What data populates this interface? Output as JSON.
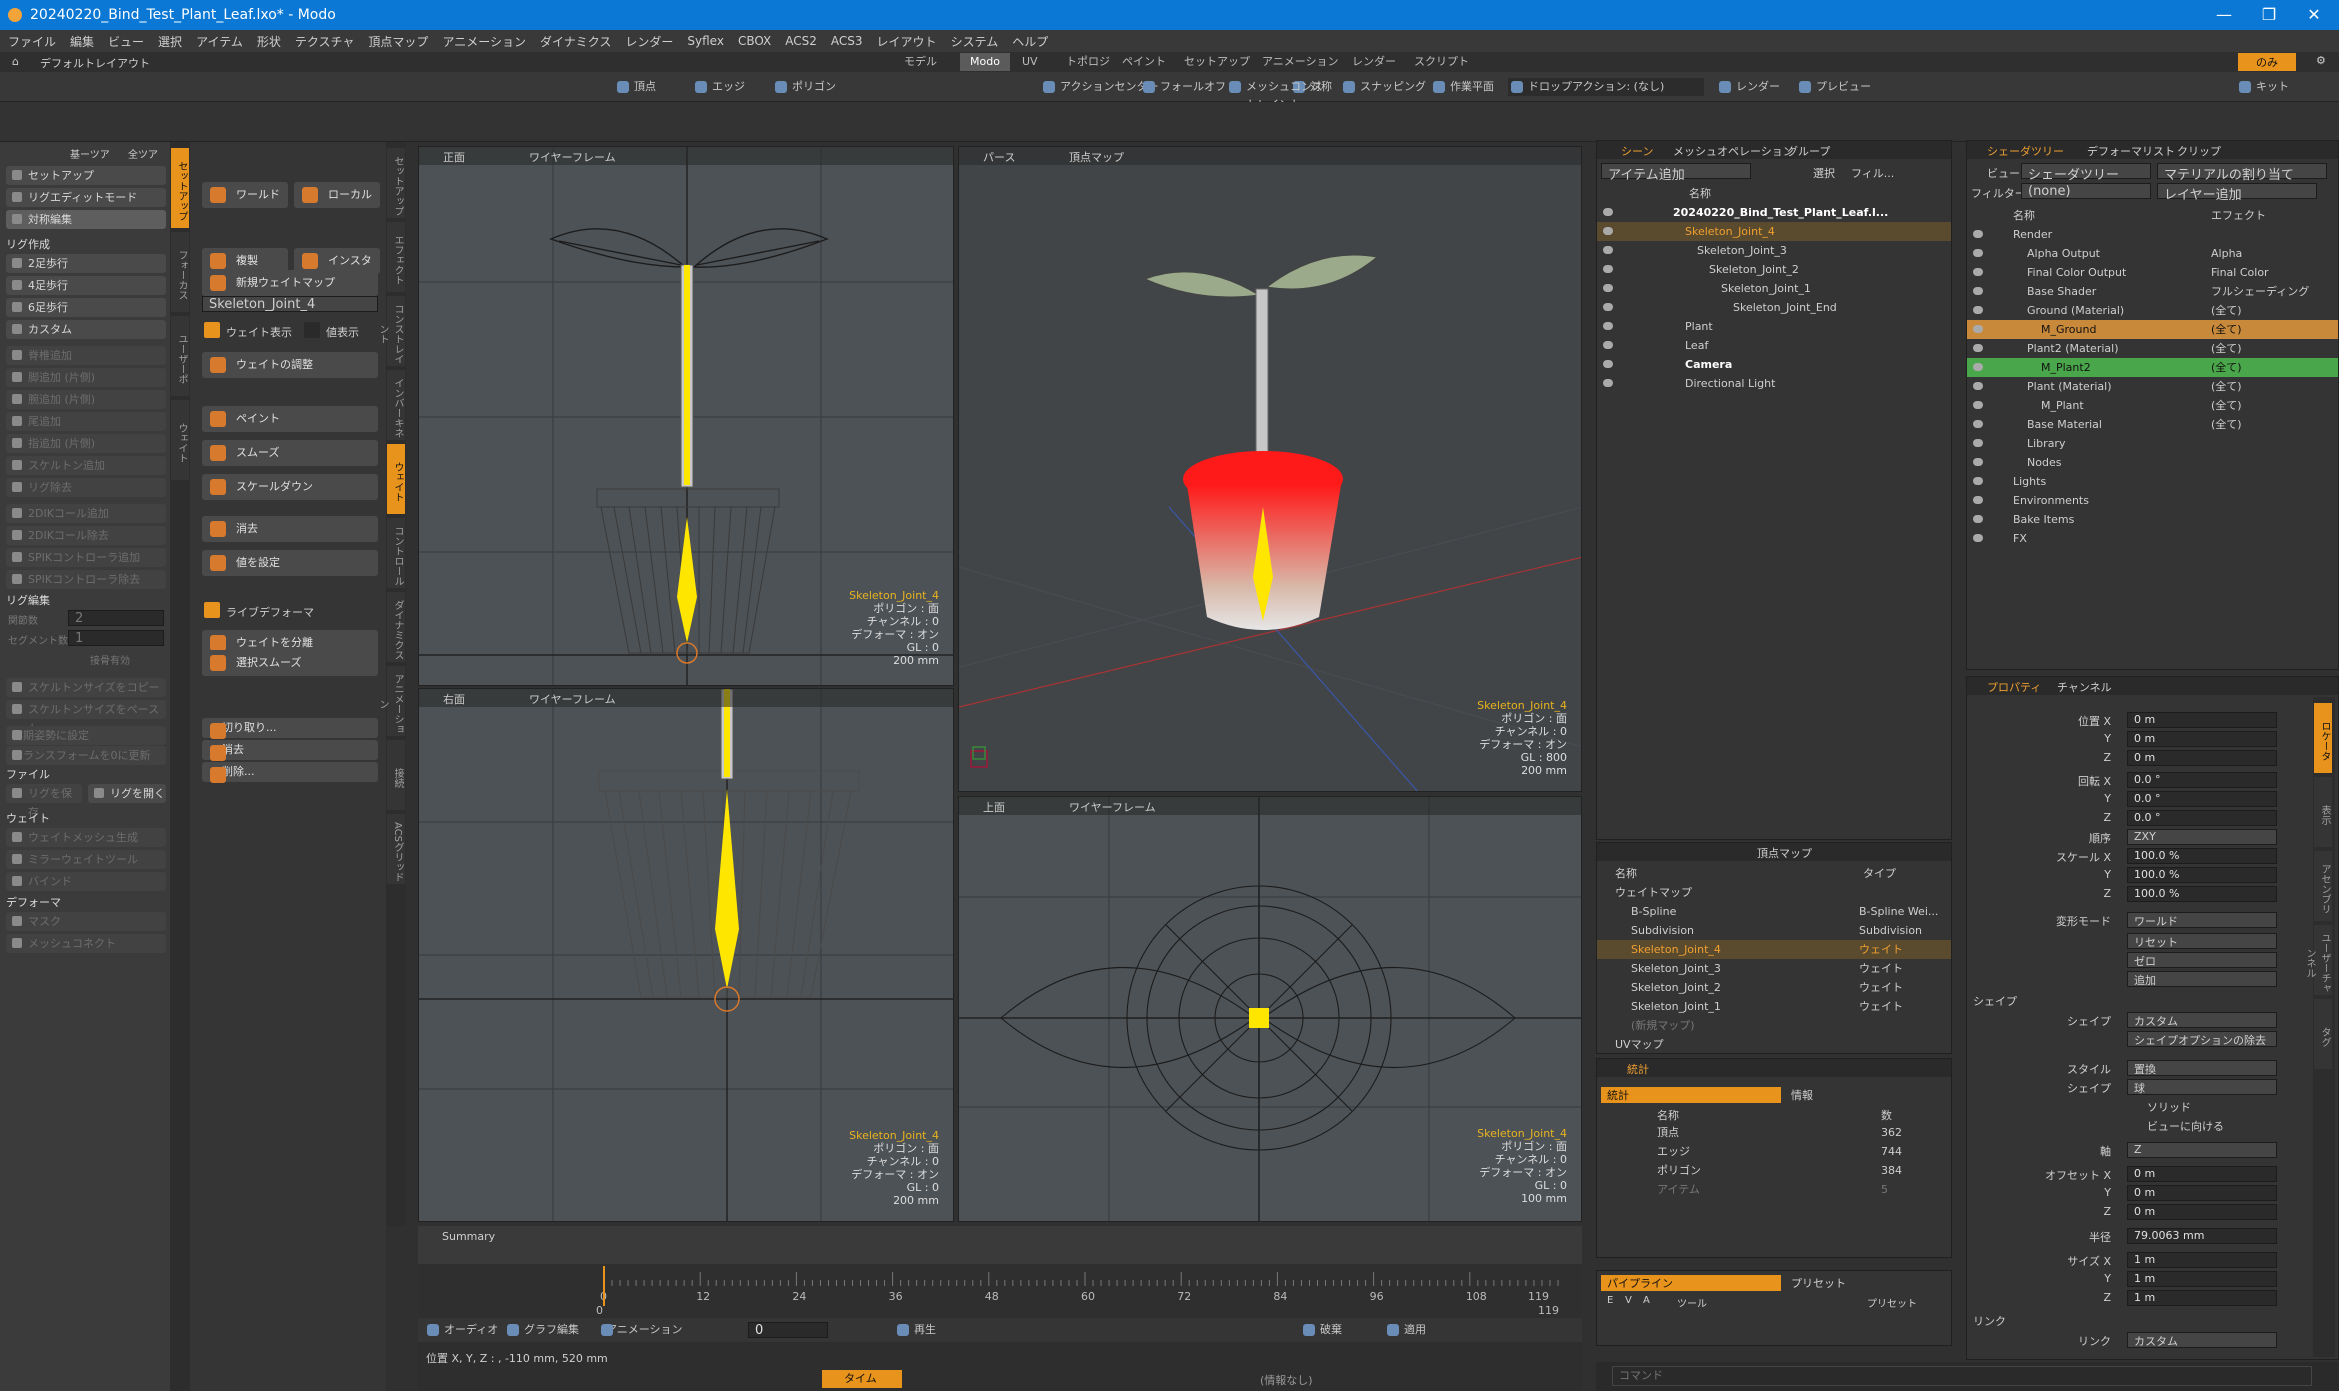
{
  "window": {
    "title": "20240220_Bind_Test_Plant_Leaf.lxo* - Modo",
    "controls": [
      "—",
      "❐",
      "✕"
    ]
  },
  "menu": [
    "ファイル",
    "編集",
    "ビュー",
    "選択",
    "アイテム",
    "形状",
    "テクスチャ",
    "頂点マップ",
    "アニメーション",
    "ダイナミクス",
    "レンダー",
    "Syflex",
    "CBOX",
    "ACS2",
    "ACS3",
    "レイアウト",
    "システム",
    "ヘルプ"
  ],
  "layout_label": "デフォルトレイアウト",
  "mode_tabs": [
    "モデル",
    "Modo",
    "UV",
    "トポロジ",
    "ペイント",
    "セットアップ",
    "アニメーション",
    "レンダー",
    "スクリプト"
  ],
  "mode_active": "Modo",
  "mode_right": "のみ",
  "toolbar": [
    "頂点",
    "エッジ",
    "ポリゴン",
    "アクションセンター",
    "フォールオフ",
    "メッシュコンストレイント",
    "対称",
    "スナッピング",
    "作業平面",
    "ドロップアクション: (なし)",
    "レンダー",
    "プレビュー",
    "キット"
  ],
  "left": {
    "header": [
      "基ーツア",
      "全ツア"
    ],
    "buttons": [
      {
        "label": "セットアップ",
        "dis": false
      },
      {
        "label": "リグエディットモード",
        "dis": false
      },
      {
        "label": "対称編集",
        "dis": false,
        "sel": true
      }
    ],
    "rig_create": "リグ作成",
    "rig_buttons": [
      {
        "label": "2足歩行",
        "dis": false
      },
      {
        "label": "4足歩行",
        "dis": false
      },
      {
        "label": "6足歩行",
        "dis": false
      },
      {
        "label": "カスタム",
        "dis": false
      },
      {
        "label": "脊椎追加",
        "dis": true
      },
      {
        "label": "脚追加 (片側)",
        "dis": true
      },
      {
        "label": "腕追加 (片側)",
        "dis": true
      },
      {
        "label": "尾追加",
        "dis": true
      },
      {
        "label": "指追加 (片側)",
        "dis": true
      },
      {
        "label": "スケルトン追加",
        "dis": true
      },
      {
        "label": "リグ除去",
        "dis": true
      },
      {
        "label": "2DIKコール追加",
        "dis": true
      },
      {
        "label": "2DIKコール除去",
        "dis": true
      },
      {
        "label": "SPIKコントローラ追加",
        "dis": true
      },
      {
        "label": "SPIKコントローラ除去",
        "dis": true
      }
    ],
    "rig_edit": "リグ編集",
    "joint_count_label": "関節数",
    "joint_count": "2",
    "segment_label": "セグメント数",
    "segment": "1",
    "bone_enable": "接骨有効",
    "copy_size": "スケルトンサイズをコピー",
    "paste_size": "スケルトンサイズをペースト",
    "init_pose": "初期姿勢に設定",
    "transform_reset": "トランスフォームを0に更新",
    "file": "ファイル",
    "save_rig": "リグを保存",
    "open_rig": "リグを開く",
    "weight": "ウェイト",
    "gen_weight": "ウェイトメッシュ生成",
    "mirror_weight": "ミラーウェイトツール",
    "bind": "バインド",
    "deformer": "デフォーマ",
    "mask": "マスク",
    "mesh_conn": "メッシュコネクト"
  },
  "tools": {
    "world": "ワールド",
    "local": "ローカル",
    "duplicate": "複製",
    "instance": "インスタンス",
    "new_weight_map": "新規ウェイトマップ",
    "weight_map_sel": "Skeleton_Joint_4",
    "show_weight": "ウェイト表示",
    "show_values": "値表示",
    "adjust": "ウェイトの調整",
    "paint": "ペイント",
    "smooth": "スムーズ",
    "scale_down": "スケールダウン",
    "erase": "消去",
    "set_value": "値を設定",
    "live_deformer": "ライブデフォーマ",
    "split_weight": "ウェイトを分離",
    "select_smooth": "選択スムーズ",
    "cut": "切り取り...",
    "delete": "消去",
    "remove": "削除..."
  },
  "side_tabs": [
    "セットアップ",
    "フォーカス",
    "ユーザーポ",
    "ウェイト"
  ],
  "side_tabs2": [
    "セットアップ",
    "エフェクト",
    "コンストレイント",
    "インバーキネ",
    "ウェイト",
    "コントロール",
    "ダイナミクス",
    "アニメーション",
    "接続",
    "ACSグリッド"
  ],
  "viewports": {
    "front": {
      "name": "正面",
      "mode": "ワイヤーフレーム",
      "joint": "Skeleton_Joint_4",
      "poly": "ポリゴン : 面",
      "chan": "チャンネル : 0",
      "deform": "デフォーマ : オン",
      "gl": "GL : 0",
      "size": "200 mm"
    },
    "persp": {
      "name": "パース",
      "mode": "頂点マップ",
      "joint": "Skeleton_Joint_4",
      "poly": "ポリゴン : 面",
      "chan": "チャンネル : 0",
      "deform": "デフォーマ : オン",
      "gl": "GL : 800",
      "size": "200 mm"
    },
    "right": {
      "name": "右面",
      "mode": "ワイヤーフレーム",
      "joint": "Skeleton_Joint_4",
      "poly": "ポリゴン : 面",
      "chan": "チャンネル : 0",
      "deform": "デフォーマ : オン",
      "gl": "GL : 0",
      "size": "200 mm"
    },
    "top": {
      "name": "上面",
      "mode": "ワイヤーフレーム",
      "joint": "Skeleton_Joint_4",
      "poly": "ポリゴン : 面",
      "chan": "チャンネル : 0",
      "deform": "デフォーマ : オン",
      "gl": "GL : 0",
      "size": "100 mm"
    }
  },
  "scene": {
    "tabs": [
      "シーン",
      "メッシュオペレーション",
      "グループ"
    ],
    "add_item": "アイテム追加",
    "select": "選択",
    "filter": "フィル...",
    "name_col": "名称",
    "items": [
      {
        "label": "20240220_Bind_Test_Plant_Leaf.l...",
        "indent": 0,
        "bold": true
      },
      {
        "label": "Skeleton_Joint_4",
        "indent": 1,
        "sel": true
      },
      {
        "label": "Skeleton_Joint_3",
        "indent": 2
      },
      {
        "label": "Skeleton_Joint_2",
        "indent": 3
      },
      {
        "label": "Skeleton_Joint_1",
        "indent": 4
      },
      {
        "label": "Skeleton_Joint_End",
        "indent": 5
      },
      {
        "label": "Plant",
        "indent": 1
      },
      {
        "label": "Leaf",
        "indent": 1
      },
      {
        "label": "Camera",
        "indent": 1,
        "bold": true
      },
      {
        "label": "Directional Light",
        "indent": 1
      }
    ]
  },
  "vmap": {
    "title": "頂点マップ",
    "col_name": "名称",
    "col_type": "タイプ",
    "rows": [
      {
        "name": "ウェイトマップ",
        "type": "",
        "indent": 0
      },
      {
        "name": "B-Spline",
        "type": "B-Spline Wei...",
        "indent": 1
      },
      {
        "name": "Subdivision",
        "type": "Subdivision",
        "indent": 1
      },
      {
        "name": "Skeleton_Joint_4",
        "type": "ウェイト",
        "indent": 1,
        "sel": true
      },
      {
        "name": "Skeleton_Joint_3",
        "type": "ウェイト",
        "indent": 1
      },
      {
        "name": "Skeleton_Joint_2",
        "type": "ウェイト",
        "indent": 1
      },
      {
        "name": "Skeleton_Joint_1",
        "type": "ウェイト",
        "indent": 1
      },
      {
        "name": "(新規マップ)",
        "type": "",
        "indent": 1,
        "dim": true
      },
      {
        "name": "UVマップ",
        "type": "",
        "indent": 0
      }
    ]
  },
  "stats": {
    "tabs": [
      "統計",
      "情報"
    ],
    "col_name": "名称",
    "col_num": "数",
    "rows": [
      {
        "name": "頂点",
        "num": "362"
      },
      {
        "name": "エッジ",
        "num": "744"
      },
      {
        "name": "ポリゴン",
        "num": "384"
      },
      {
        "name": "アイテム",
        "num": "5"
      }
    ]
  },
  "pipeline": {
    "tabs": [
      "パイプライン",
      "プリセット"
    ],
    "cols": [
      "E",
      "V",
      "A",
      "ツール",
      "プリセット"
    ]
  },
  "shader": {
    "tabs": [
      "シェーダツリー",
      "デフォーマリスト",
      "クリップ"
    ],
    "view_label": "ビュー",
    "view": "シェーダツリー",
    "assign": "マテリアルの割り当て",
    "filter_label": "フィルター",
    "filter": "(none)",
    "add_layer": "レイヤー追加",
    "col_name": "名称",
    "col_effect": "エフェクト",
    "rows": [
      {
        "name": "Render",
        "effect": "",
        "indent": 0
      },
      {
        "name": "Alpha Output",
        "effect": "Alpha",
        "indent": 1
      },
      {
        "name": "Final Color Output",
        "effect": "Final Color",
        "indent": 1
      },
      {
        "name": "Base Shader",
        "effect": "フルシェーディング",
        "indent": 1
      },
      {
        "name": "Ground (Material)",
        "effect": "(全て)",
        "indent": 1
      },
      {
        "name": "M_Ground",
        "effect": "(全て)",
        "indent": 2,
        "hl": "#c88a3a"
      },
      {
        "name": "Plant2 (Material)",
        "effect": "(全て)",
        "indent": 1
      },
      {
        "name": "M_Plant2",
        "effect": "(全て)",
        "indent": 2,
        "hl": "#4aa64a"
      },
      {
        "name": "Plant (Material)",
        "effect": "(全て)",
        "indent": 1
      },
      {
        "name": "M_Plant",
        "effect": "(全て)",
        "indent": 2
      },
      {
        "name": "Base Material",
        "effect": "(全て)",
        "indent": 1
      },
      {
        "name": "Library",
        "effect": "",
        "indent": 1
      },
      {
        "name": "Nodes",
        "effect": "",
        "indent": 1
      },
      {
        "name": "Lights",
        "effect": "",
        "indent": 0
      },
      {
        "name": "Environments",
        "effect": "",
        "indent": 0
      },
      {
        "name": "Bake Items",
        "effect": "",
        "indent": 0
      },
      {
        "name": "FX",
        "effect": "",
        "indent": 0
      }
    ]
  },
  "props": {
    "tabs": [
      "プロパティ",
      "チャンネル"
    ],
    "pos_label": "位置 X",
    "y": "Y",
    "z": "Z",
    "pos": [
      "0 m",
      "0 m",
      "0 m"
    ],
    "rot_label": "回転 X",
    "rot": [
      "0.0 °",
      "0.0 °",
      "0.0 °"
    ],
    "order_label": "順序",
    "order": "ZXY",
    "scale_label": "スケール X",
    "scale": [
      "100.0 %",
      "100.0 %",
      "100.0 %"
    ],
    "xform_label": "変形モード",
    "xform": "ワールド",
    "reset": "リセット",
    "zero": "ゼロ",
    "add": "追加",
    "shape_sec": "シェイプ",
    "shape_label": "シェイプ",
    "shape": "カスタム",
    "shape_opt": "シェイプオプションの除去",
    "style_label": "スタイル",
    "style": "置換",
    "shape2_label": "シェイプ",
    "shape2": "球",
    "solid": "ソリッド",
    "face_view": "ビューに向ける",
    "axis_label": "軸",
    "axis": "Z",
    "offset_label": "オフセット X",
    "offset": [
      "0 m",
      "0 m",
      "0 m"
    ],
    "radius_label": "半径",
    "radius": "79.0063 mm",
    "size_label": "サイズ X",
    "size": [
      "1 m",
      "1 m",
      "1 m"
    ],
    "link_sec": "リンク",
    "link_label": "リンク",
    "link": "カスタム",
    "side_tabs": [
      "ロケータ",
      "表示",
      "アセンブリ",
      "ユーザーチャンネル",
      "タグ"
    ]
  },
  "timeline": {
    "summary": "Summary",
    "ticks": [
      "0",
      "12",
      "24",
      "36",
      "48",
      "60",
      "72",
      "84",
      "96",
      "108"
    ],
    "start": "0",
    "end": "119",
    "marker": "119"
  },
  "transport": {
    "audio": "オーディオ",
    "graph": "グラフ編集",
    "anim": "アニメーション",
    "frame": "0",
    "play": "再生",
    "key": "破棄",
    "apply": "適用"
  },
  "status": {
    "pos": "位置 X, Y, Z : , -110 mm, 520 mm",
    "time": "タイム",
    "info": "(情報なし)"
  },
  "command": {
    "placeholder": "コマンド"
  },
  "colors": {
    "accent": "#e8931b",
    "title": "#0a78d4",
    "joint": "#e8b31e",
    "weight": "#ffe600",
    "red": "#ff1a1a"
  }
}
